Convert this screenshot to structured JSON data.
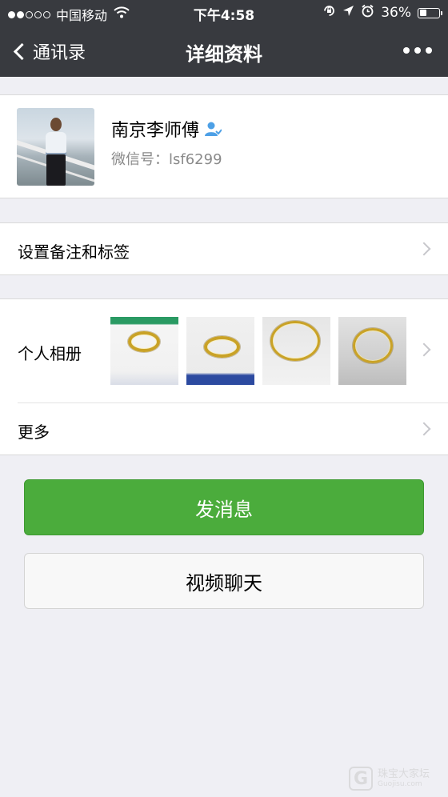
{
  "status_bar": {
    "carrier": "中国移动",
    "time": "下午4:58",
    "battery": "36%",
    "battery_level": 0.36,
    "signal_bars_filled": 2,
    "signal_bars_total": 5,
    "icons": [
      "wifi-icon",
      "rotation-lock-icon",
      "location-icon",
      "alarm-icon",
      "battery-icon"
    ]
  },
  "nav": {
    "back_label": "通讯录",
    "title": "详细资料",
    "more_icon": "more-dots-icon"
  },
  "profile": {
    "name": "南京李师傅",
    "wechat_id": "微信号：lsf6299",
    "badge_icon": "contact-person-icon",
    "badge_color": "#4da0e6"
  },
  "rows": {
    "remark_label": "设置备注和标签",
    "album_label": "个人相册",
    "more_label": "更多"
  },
  "album": {
    "photos": [
      "gold-bangle-photo",
      "gold-bangle-photo",
      "gold-bangle-photo",
      "gold-bangle-photo"
    ]
  },
  "buttons": {
    "send_message": "发消息",
    "video_call": "视频聊天"
  },
  "colors": {
    "navbar": "#383a3f",
    "primary_button": "#4bac3c",
    "background": "#efeff4"
  },
  "watermark": {
    "logo": "G",
    "cn": "珠宝大家坛",
    "en": "Guojisu.com"
  }
}
